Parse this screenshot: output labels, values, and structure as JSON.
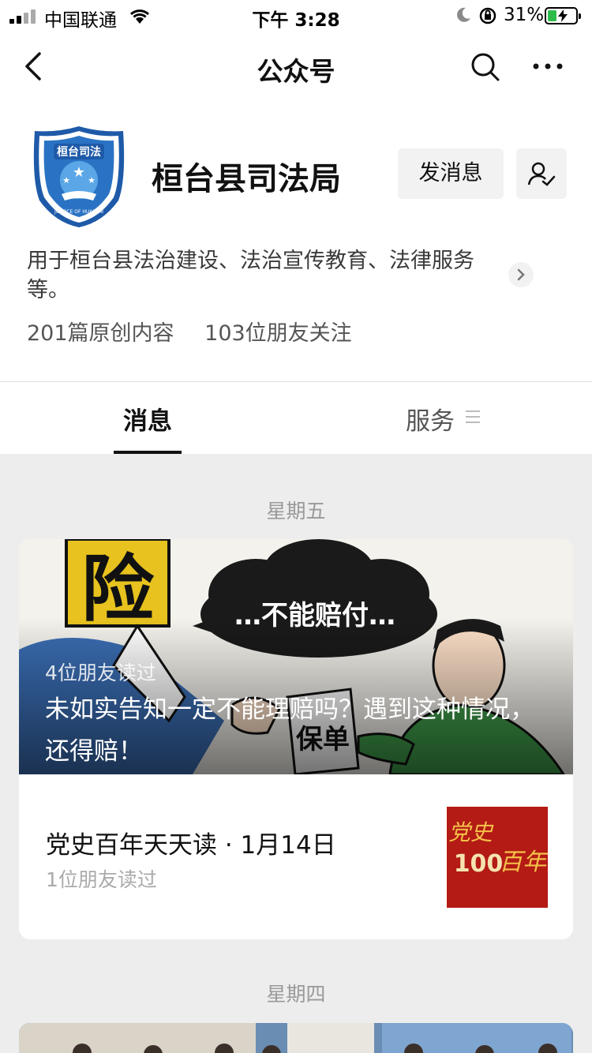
{
  "status_bar": {
    "carrier": "中国联通",
    "time": "下午 3:28",
    "battery_percent": "31%"
  },
  "nav": {
    "title": "公众号"
  },
  "profile": {
    "logo_text": "桓台司法",
    "logo_subtext": "JUSTICE OF HUANTAI",
    "name": "桓台县司法局",
    "message_button": "发消息",
    "description": "用于桓台县法治建设、法治宣传教育、法律服务等。",
    "original_count": "201篇原创内容",
    "followers": "103位朋友关注"
  },
  "tabs": {
    "messages": "消息",
    "services": "服务"
  },
  "feed": {
    "day1": "星期五",
    "hero": {
      "readers": "4位朋友读过",
      "title": "未如实告知一定不能理赔吗？遇到这种情况，还得赔！",
      "image_text_bubble": "…不能赔付…",
      "image_text_sign": "险",
      "image_text_paper": "保单"
    },
    "item": {
      "title": "党史百年天天读 · 1月14日",
      "readers": "1位朋友读过",
      "thumb_text_top": "党史",
      "thumb_text_num": "100",
      "thumb_text_bottom": "百年"
    },
    "day2": "星期四"
  },
  "colors": {
    "background": "#ededed",
    "battery_fill": "#2dbb4b",
    "thumb_bg": "#b31b14",
    "logo_blue": "#1e5aa8"
  }
}
